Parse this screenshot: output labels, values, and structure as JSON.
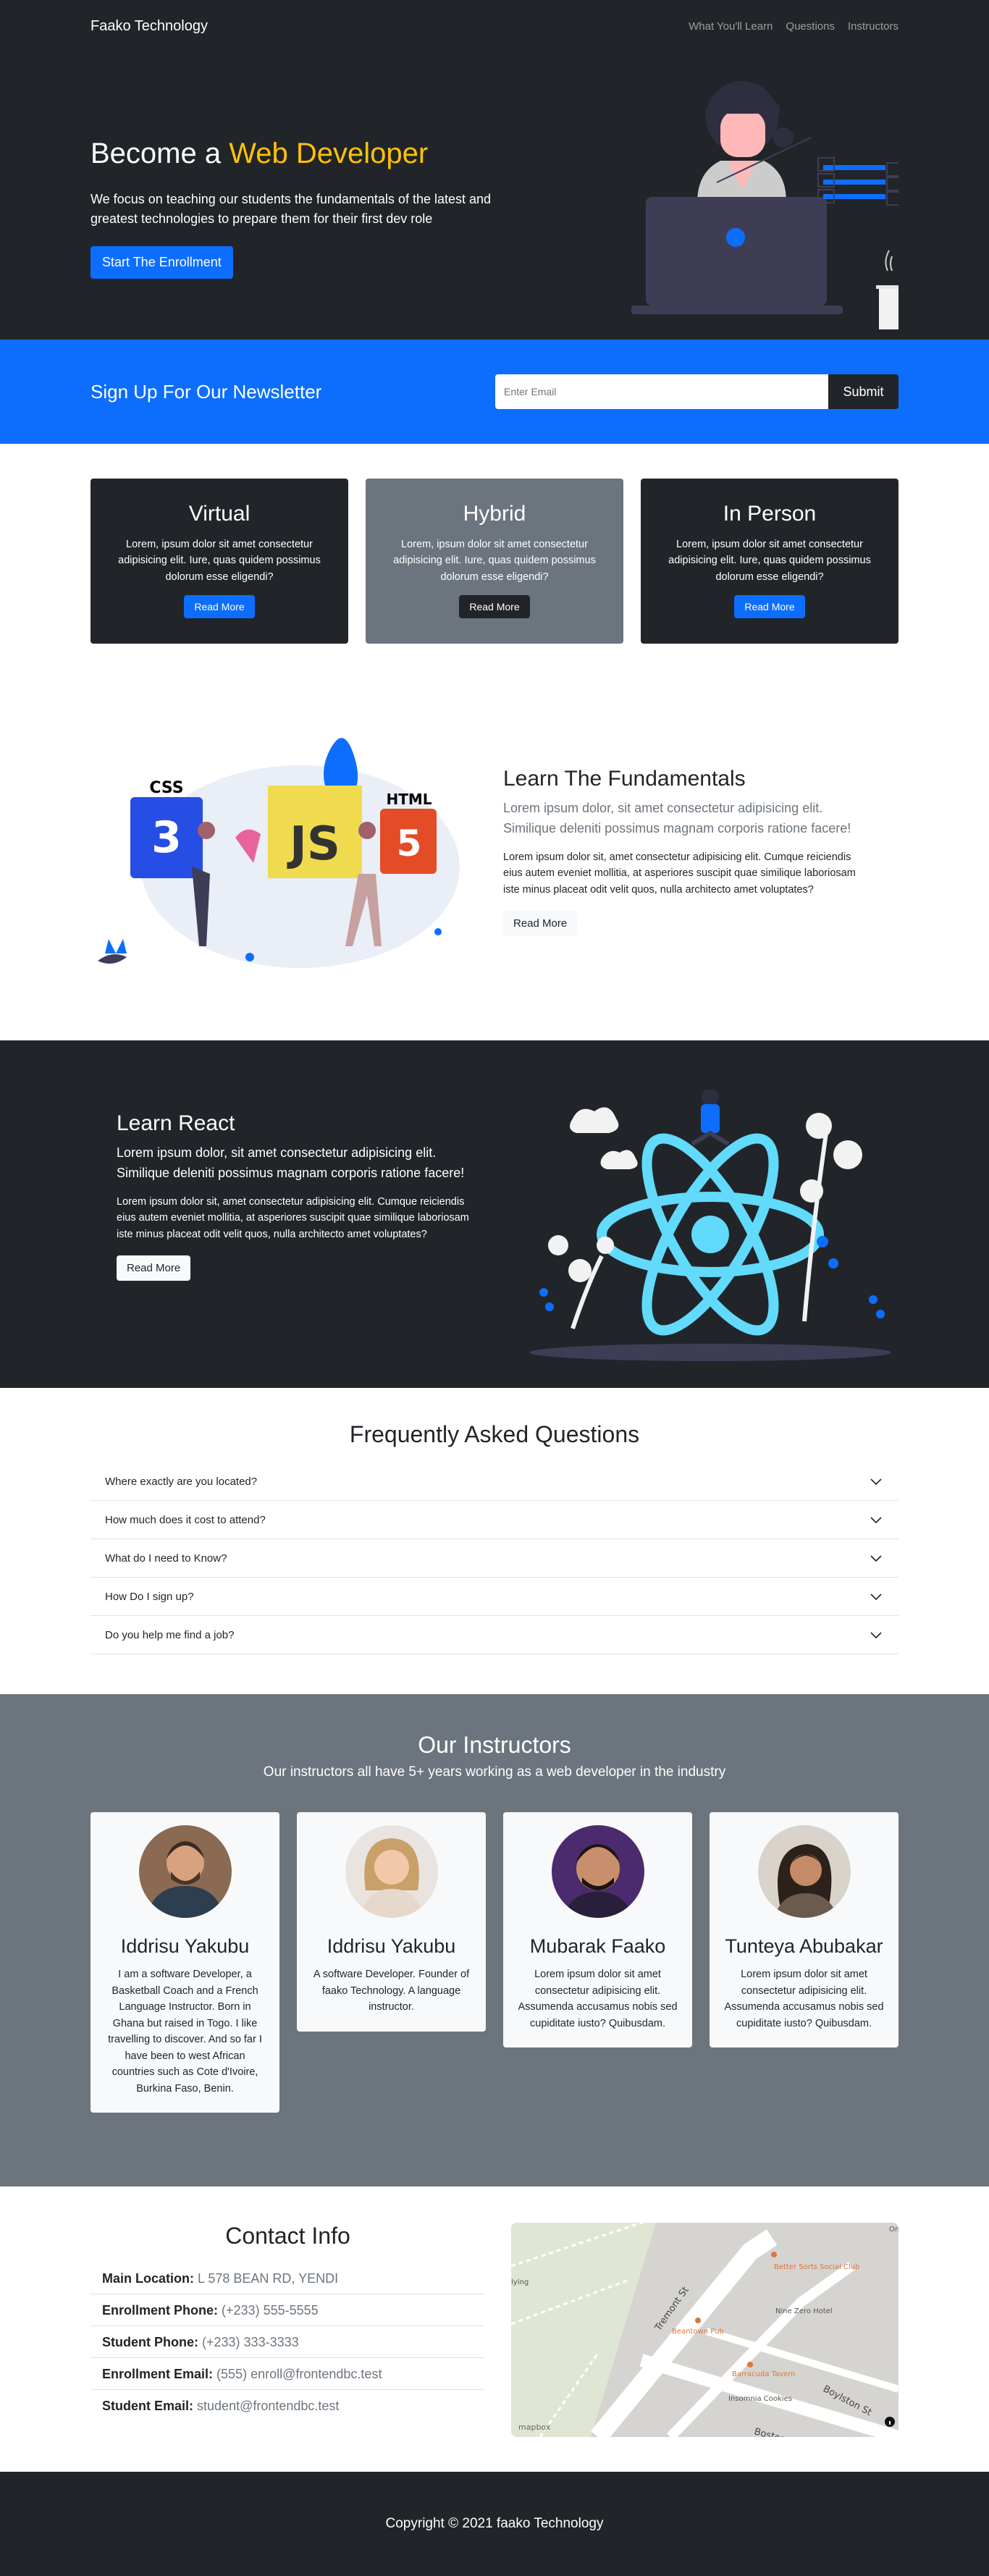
{
  "nav": {
    "brand": "Faako Technology",
    "links": [
      "What You'll Learn",
      "Questions",
      "Instructors"
    ]
  },
  "hero": {
    "title_prefix": "Become a ",
    "title_accent": "Web Developer",
    "text": "We focus on teaching our students the fundamentals of the latest and greatest technologies to prepare them for their first dev role",
    "button": "Start The Enrollment"
  },
  "newsletter": {
    "heading": "Sign Up For Our Newsletter",
    "placeholder": "Enter Email",
    "button": "Submit"
  },
  "boxes": [
    {
      "title": "Virtual",
      "text": "Lorem, ipsum dolor sit amet consectetur adipisicing elit. Iure, quas quidem possimus dolorum esse eligendi?",
      "button": "Read More"
    },
    {
      "title": "Hybrid",
      "text": "Lorem, ipsum dolor sit amet consectetur adipisicing elit. Iure, quas quidem possimus dolorum esse eligendi?",
      "button": "Read More"
    },
    {
      "title": "In Person",
      "text": "Lorem, ipsum dolor sit amet consectetur adipisicing elit. Iure, quas quidem possimus dolorum esse eligendi?",
      "button": "Read More"
    }
  ],
  "learn1": {
    "title": "Learn The Fundamentals",
    "lead": "Lorem ipsum dolor, sit amet consectetur adipisicing elit. Similique deleniti possimus magnam corporis ratione facere!",
    "body": "Lorem ipsum dolor sit, amet consectetur adipisicing elit. Cumque reiciendis eius autem eveniet mollitia, at asperiores suscipit quae similique laboriosam iste minus placeat odit velit quos, nulla architecto amet voluptates?",
    "button": "Read More",
    "badges": [
      "CSS",
      "JS",
      "HTML"
    ]
  },
  "learn2": {
    "title": "Learn React",
    "lead": "Lorem ipsum dolor, sit amet consectetur adipisicing elit. Similique deleniti possimus magnam corporis ratione facere!",
    "body": "Lorem ipsum dolor sit, amet consectetur adipisicing elit. Cumque reiciendis eius autem eveniet mollitia, at asperiores suscipit quae similique laboriosam iste minus placeat odit velit quos, nulla architecto amet voluptates?",
    "button": "Read More"
  },
  "faq": {
    "title": "Frequently Asked Questions",
    "items": [
      "Where exactly are you located?",
      "How much does it cost to attend?",
      "What do I need to Know?",
      "How Do I sign up?",
      "Do you help me find a job?"
    ]
  },
  "instructors": {
    "title": "Our Instructors",
    "subtitle": "Our instructors all have 5+ years working as a web developer in the industry",
    "cards": [
      {
        "name": "Iddrisu Yakubu",
        "bio": "I am a software Developer, a Basketball Coach and a French Language Instructor. Born in Ghana but raised in Togo. I like travelling to discover. And so far I have been to west African countries such as Cote d'Ivoire, Burkina Faso, Benin."
      },
      {
        "name": "Iddrisu Yakubu",
        "bio": "A software Developer. Founder of faako Technology. A language instructor."
      },
      {
        "name": "Mubarak Faako",
        "bio": "Lorem ipsum dolor sit amet consectetur adipisicing elit. Assumenda accusamus nobis sed cupiditate iusto? Quibusdam."
      },
      {
        "name": "Tunteya Abubakar",
        "bio": "Lorem ipsum dolor sit amet consectetur adipisicing elit. Assumenda accusamus nobis sed cupiditate iusto? Quibusdam."
      }
    ]
  },
  "contact": {
    "title": "Contact Info",
    "items": [
      {
        "label": "Main Location:",
        "value": "L 578 BEAN RD, YENDI"
      },
      {
        "label": "Enrollment Phone:",
        "value": "(+233) 555-5555"
      },
      {
        "label": "Student Phone:",
        "value": "(+233) 333-3333"
      },
      {
        "label": "Enrollment Email:",
        "value": "(555) enroll@frontendbc.test"
      },
      {
        "label": "Student Email:",
        "value": "student@frontendbc.test"
      }
    ]
  },
  "map": {
    "labels": [
      "Tremont St",
      "Boylston St",
      "Boston St",
      "Better Sorts Social Club",
      "Nine Zero Hotel",
      "Beantown Pub",
      "Barracuda Tavern",
      "Insomnia Cookies",
      "Orn",
      "lying"
    ],
    "attribution": "mapbox"
  },
  "footer": {
    "text": "Copyright © 2021 faako Technology"
  },
  "colors": {
    "dark": "#212529",
    "primary": "#0d6efd",
    "accent": "#ffc107",
    "gray": "#6c757d",
    "light": "#f8f9fa"
  }
}
